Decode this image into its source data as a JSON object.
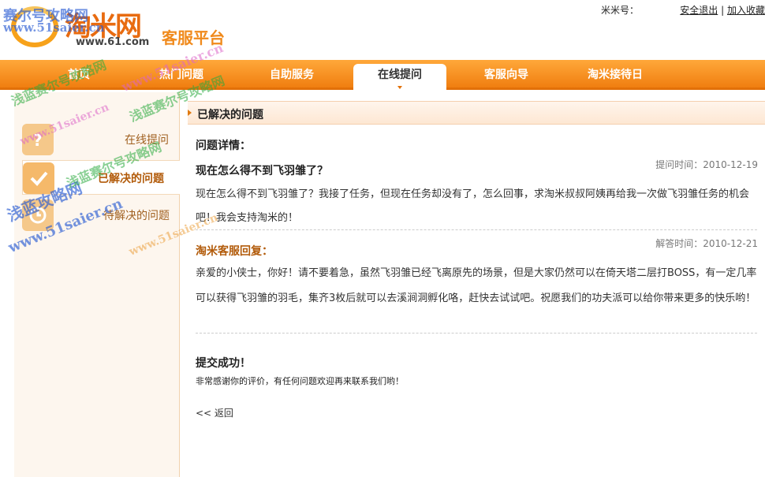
{
  "header": {
    "logo_text": "淘米网",
    "logo_url": "www.61.com",
    "logo_sub": "客服平台",
    "account_label": "米米号：",
    "logout": "安全退出",
    "separator": "|",
    "bookmark": "加入收藏"
  },
  "nav": {
    "items": [
      {
        "label": "首页"
      },
      {
        "label": "热门问题"
      },
      {
        "label": "自助服务"
      },
      {
        "label": "在线提问"
      },
      {
        "label": "客服向导"
      },
      {
        "label": "淘米接待日"
      }
    ],
    "active": "在线提问"
  },
  "sidebar": {
    "items": [
      {
        "label": "在线提问"
      },
      {
        "label": "已解决的问题"
      },
      {
        "label": "待解决的问题"
      }
    ]
  },
  "main": {
    "section_title": "已解决的问题",
    "detail_label": "问题详情：",
    "question": {
      "title": "现在怎么得不到飞羽雏了？",
      "time": "提问时间：2010-12-19",
      "body": "现在怎么得不到飞羽雏了？我接了任务，但现在任务却没有了，怎么回事，求淘米叔叔阿姨再给我一次做飞羽雏任务的机会吧！我会支持淘米的！"
    },
    "answer": {
      "title": "淘米客服回复：",
      "time": "解答时间：2010-12-21",
      "body": "亲爱的小侠士，你好！请不要着急，虽然飞羽雏已经飞离原先的场景，但是大家仍然可以在倚天塔二层打BOSS，有一定几率可以获得飞羽雏的羽毛，集齐3枚后就可以去溪涧洞孵化咯，赶快去试试吧。祝愿我们的功夫派可以给你带来更多的快乐哟！"
    },
    "success_title": "提交成功！",
    "success_msg": "非常感谢你的评价，有任何问题欢迎再来联系我们哟！",
    "back": "<< 返回"
  },
  "watermark": {
    "site_cn": "赛尔号攻略网",
    "site_url": "www.51saier.cn",
    "site_alt": "浅蓝赛尔号攻略网",
    "site_short": "浅蓝攻略网"
  },
  "colors": {
    "nav_orange": "#f07e10",
    "accent_brown": "#b25b0a",
    "sidebar_bg": "#fdf6ee"
  }
}
